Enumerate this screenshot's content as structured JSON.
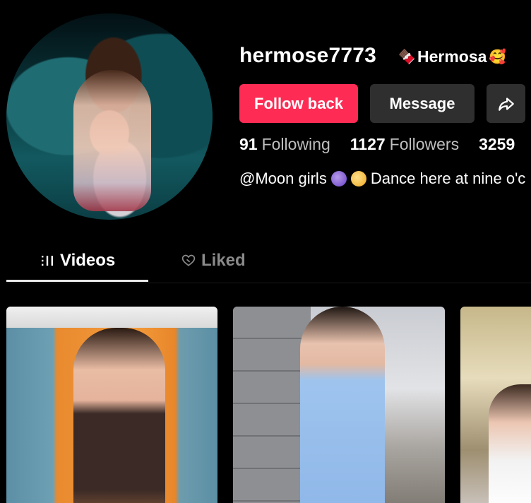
{
  "profile": {
    "username": "hermose7773",
    "nickname_prefix_emoji": "🍫",
    "nickname": "Hermosa",
    "nickname_suffix_emoji": "🥰"
  },
  "actions": {
    "follow_label": "Follow back",
    "message_label": "Message",
    "share_icon": "share-icon"
  },
  "stats": {
    "following_count": "91",
    "following_label": "Following",
    "followers_count": "1127",
    "followers_label": "Followers",
    "likes_count": "3259"
  },
  "bio": {
    "part1": "@Moon girls",
    "part2": "Dance here at nine o'c"
  },
  "tabs": [
    {
      "label": "Videos",
      "icon": "grid-bars-icon",
      "active": true
    },
    {
      "label": "Liked",
      "icon": "heart-outline-icon",
      "active": false
    }
  ],
  "colors": {
    "accent": "#fe2c55",
    "secondary_button": "#2f2f2f",
    "background": "#000000"
  }
}
